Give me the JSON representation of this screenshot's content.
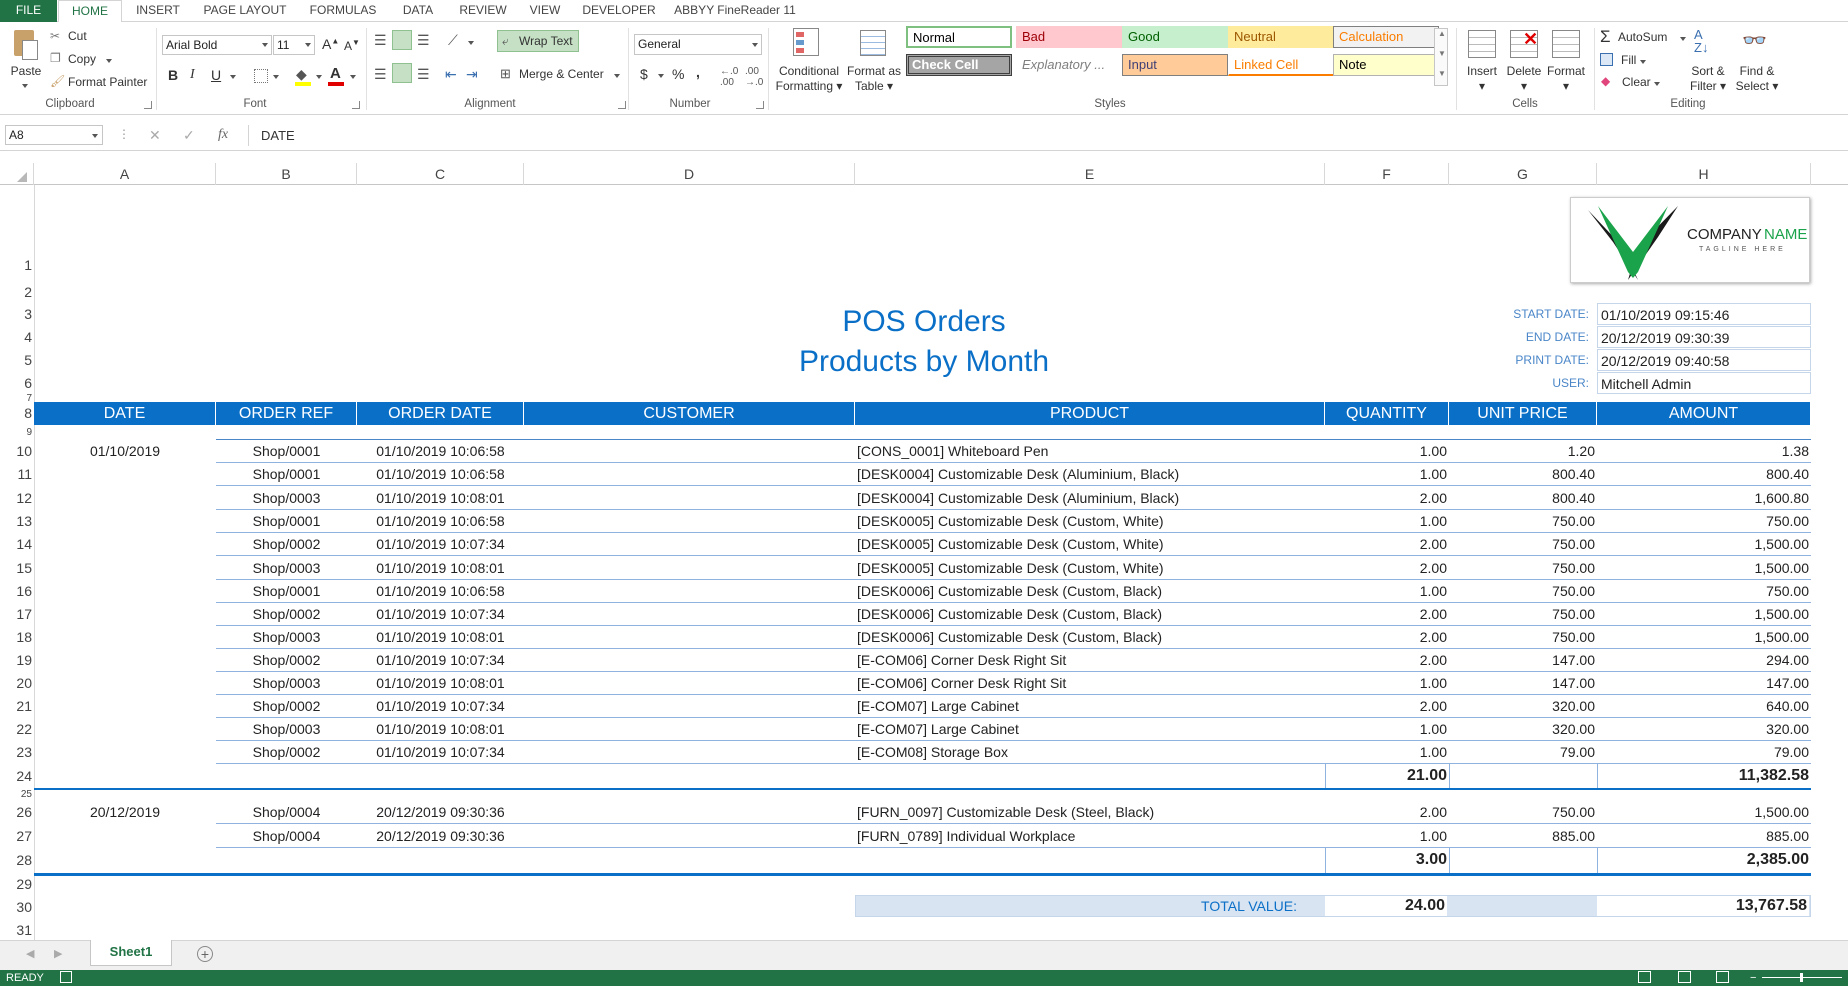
{
  "menu": {
    "file": "FILE",
    "tabs": [
      "HOME",
      "INSERT",
      "PAGE LAYOUT",
      "FORMULAS",
      "DATA",
      "REVIEW",
      "VIEW",
      "DEVELOPER",
      "ABBYY FineReader 11"
    ]
  },
  "ribbon": {
    "clipboard": {
      "paste": "Paste",
      "cut": "Cut",
      "copy": "Copy",
      "format_painter": "Format Painter",
      "label": "Clipboard"
    },
    "font": {
      "name": "Arial Bold",
      "size": "11",
      "label": "Font",
      "bold": "B",
      "italic": "I",
      "underline": "U"
    },
    "alignment": {
      "wrap_text": "Wrap Text",
      "merge_center": "Merge & Center",
      "label": "Alignment"
    },
    "number": {
      "format": "General",
      "currency": "$",
      "percent": "%",
      "comma": ",",
      "label": "Number"
    },
    "styles": {
      "conditional": "Conditional",
      "conditional2": "Formatting",
      "format_table": "Format as",
      "format_table2": "Table",
      "cells": [
        {
          "name": "Normal",
          "bg": "#ffffff",
          "fg": "#000000",
          "border": "#7fbf7f"
        },
        {
          "name": "Bad",
          "bg": "#ffc7ce",
          "fg": "#9c0006",
          "border": "#ffc7ce"
        },
        {
          "name": "Good",
          "bg": "#c6efce",
          "fg": "#006100",
          "border": "#c6efce"
        },
        {
          "name": "Neutral",
          "bg": "#ffeb9c",
          "fg": "#9c5700",
          "border": "#ffeb9c"
        },
        {
          "name": "Calculation",
          "bg": "#f2f2f2",
          "fg": "#fa7d00",
          "border": "#7f7f7f"
        },
        {
          "name": "Check Cell",
          "bg": "#a5a5a5",
          "fg": "#ffffff",
          "border": "#3f3f3f"
        },
        {
          "name": "Explanatory ...",
          "bg": "#ffffff",
          "fg": "#7f7f7f",
          "border": "#ffffff"
        },
        {
          "name": "Input",
          "bg": "#ffcc99",
          "fg": "#3f3f76",
          "border": "#7f7f7f"
        },
        {
          "name": "Linked Cell",
          "bg": "#ffffff",
          "fg": "#fa7d00",
          "border": "#ffffff"
        },
        {
          "name": "Note",
          "bg": "#ffffcc",
          "fg": "#000000",
          "border": "#b2b2b2"
        }
      ],
      "label": "Styles"
    },
    "cells": {
      "insert": "Insert",
      "delete": "Delete",
      "format": "Format",
      "label": "Cells"
    },
    "editing": {
      "autosum": "AutoSum",
      "fill": "Fill",
      "clear": "Clear",
      "sort": "Sort &",
      "sort2": "Filter",
      "find": "Find &",
      "find2": "Select",
      "label": "Editing"
    }
  },
  "formula_bar": {
    "name_box": "A8",
    "fx": "fx",
    "content": "DATE"
  },
  "columns": [
    "A",
    "B",
    "C",
    "D",
    "E",
    "F",
    "G",
    "H"
  ],
  "report": {
    "title1": "POS Orders",
    "title2": "Products by Month",
    "company": "COMPANY",
    "company_name": "NAME",
    "tagline": "TAGLINE HERE",
    "meta": [
      {
        "label": "START DATE:",
        "value": "01/10/2019 09:15:46"
      },
      {
        "label": "END DATE:",
        "value": "20/12/2019 09:30:39"
      },
      {
        "label": "PRINT DATE:",
        "value": "20/12/2019 09:40:58"
      },
      {
        "label": "USER:",
        "value": "Mitchell Admin"
      }
    ],
    "headers": [
      "DATE",
      "ORDER REF",
      "ORDER DATE",
      "CUSTOMER",
      "PRODUCT",
      "QUANTITY",
      "UNIT PRICE",
      "AMOUNT"
    ],
    "groups": [
      {
        "date": "01/10/2019",
        "rows": [
          [
            "Shop/0001",
            "01/10/2019 10:06:58",
            "[CONS_0001] Whiteboard Pen",
            "1.00",
            "1.20",
            "1.38"
          ],
          [
            "Shop/0001",
            "01/10/2019 10:06:58",
            "[DESK0004] Customizable Desk (Aluminium, Black)",
            "1.00",
            "800.40",
            "800.40"
          ],
          [
            "Shop/0003",
            "01/10/2019 10:08:01",
            "[DESK0004] Customizable Desk (Aluminium, Black)",
            "2.00",
            "800.40",
            "1,600.80"
          ],
          [
            "Shop/0001",
            "01/10/2019 10:06:58",
            "[DESK0005] Customizable Desk (Custom, White)",
            "1.00",
            "750.00",
            "750.00"
          ],
          [
            "Shop/0002",
            "01/10/2019 10:07:34",
            "[DESK0005] Customizable Desk (Custom, White)",
            "2.00",
            "750.00",
            "1,500.00"
          ],
          [
            "Shop/0003",
            "01/10/2019 10:08:01",
            "[DESK0005] Customizable Desk (Custom, White)",
            "2.00",
            "750.00",
            "1,500.00"
          ],
          [
            "Shop/0001",
            "01/10/2019 10:06:58",
            "[DESK0006] Customizable Desk (Custom, Black)",
            "1.00",
            "750.00",
            "750.00"
          ],
          [
            "Shop/0002",
            "01/10/2019 10:07:34",
            "[DESK0006] Customizable Desk (Custom, Black)",
            "2.00",
            "750.00",
            "1,500.00"
          ],
          [
            "Shop/0003",
            "01/10/2019 10:08:01",
            "[DESK0006] Customizable Desk (Custom, Black)",
            "2.00",
            "750.00",
            "1,500.00"
          ],
          [
            "Shop/0002",
            "01/10/2019 10:07:34",
            "[E-COM06] Corner Desk Right Sit",
            "2.00",
            "147.00",
            "294.00"
          ],
          [
            "Shop/0003",
            "01/10/2019 10:08:01",
            "[E-COM06] Corner Desk Right Sit",
            "1.00",
            "147.00",
            "147.00"
          ],
          [
            "Shop/0002",
            "01/10/2019 10:07:34",
            "[E-COM07] Large Cabinet",
            "2.00",
            "320.00",
            "640.00"
          ],
          [
            "Shop/0003",
            "01/10/2019 10:08:01",
            "[E-COM07] Large Cabinet",
            "1.00",
            "320.00",
            "320.00"
          ],
          [
            "Shop/0002",
            "01/10/2019 10:07:34",
            "[E-COM08] Storage Box",
            "1.00",
            "79.00",
            "79.00"
          ]
        ],
        "total_qty": "21.00",
        "total_amount": "11,382.58"
      },
      {
        "date": "20/12/2019",
        "rows": [
          [
            "Shop/0004",
            "20/12/2019 09:30:36",
            "[FURN_0097] Customizable Desk (Steel, Black)",
            "2.00",
            "750.00",
            "1,500.00"
          ],
          [
            "Shop/0004",
            "20/12/2019 09:30:36",
            "[FURN_0789] Individual Workplace",
            "1.00",
            "885.00",
            "885.00"
          ]
        ],
        "total_qty": "3.00",
        "total_amount": "2,385.00"
      }
    ],
    "grand": {
      "label": "TOTAL VALUE:",
      "qty": "24.00",
      "amount": "13,767.58"
    }
  },
  "row_numbers": [
    "1",
    "2",
    "3",
    "4",
    "5",
    "6",
    "7",
    "8",
    "9",
    "10",
    "11",
    "12",
    "13",
    "14",
    "15",
    "16",
    "17",
    "18",
    "19",
    "20",
    "21",
    "22",
    "23",
    "24",
    "25",
    "26",
    "27",
    "28",
    "29",
    "30",
    "31"
  ],
  "sheet": {
    "tab": "Sheet1"
  },
  "status": {
    "ready": "READY"
  }
}
